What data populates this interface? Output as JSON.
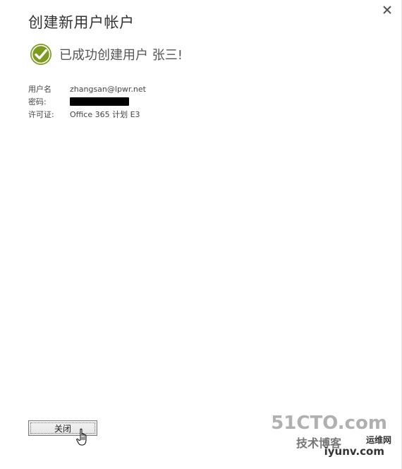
{
  "dialog": {
    "title": "创建新用户帐户",
    "success_message": "已成功创建用户 张三!",
    "details": [
      {
        "label": "用户名",
        "value": "zhangsan@lpwr.net"
      },
      {
        "label": "密码:",
        "value": ""
      },
      {
        "label": "许可证:",
        "value": "Office 365 计划 E3"
      }
    ],
    "close_button_label": "关闭"
  },
  "icons": {
    "close": "close-icon",
    "success": "checkmark-circle-icon",
    "cursor": "hand-cursor-icon"
  },
  "colors": {
    "success_green": "#7d9a1e",
    "title_text": "#333333",
    "password_mask": "#000000"
  },
  "watermark": {
    "main": "51CTO.com",
    "sub": "技术博客",
    "right": "运维网",
    "url": "iyunv.com"
  }
}
